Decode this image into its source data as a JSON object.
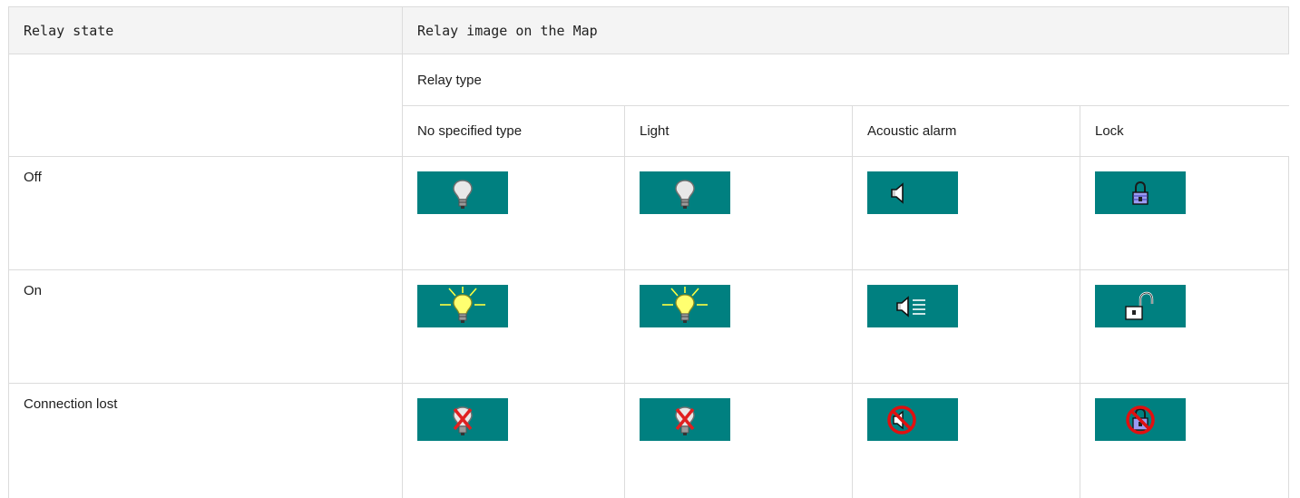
{
  "header": {
    "col_state": "Relay state",
    "col_image": "Relay image on the Map"
  },
  "subheader": {
    "relay_type_label": "Relay type"
  },
  "types": [
    "No specified type",
    "Light",
    "Acoustic alarm",
    "Lock"
  ],
  "rows": [
    {
      "state": "Off",
      "icons": [
        "bulb-off-icon",
        "bulb-off-icon",
        "speaker-off-icon",
        "padlock-closed-icon"
      ]
    },
    {
      "state": "On",
      "icons": [
        "bulb-lit-icon",
        "bulb-lit-icon",
        "speaker-sound-icon",
        "padlock-open-icon"
      ]
    },
    {
      "state": "Connection lost",
      "icons": [
        "bulb-crossed-icon",
        "bulb-crossed-icon",
        "speaker-prohibited-icon",
        "padlock-prohibited-icon"
      ]
    }
  ],
  "colors": {
    "tile_background": "#008080",
    "header_background": "#f4f4f4",
    "border": "#dcdcdc"
  }
}
